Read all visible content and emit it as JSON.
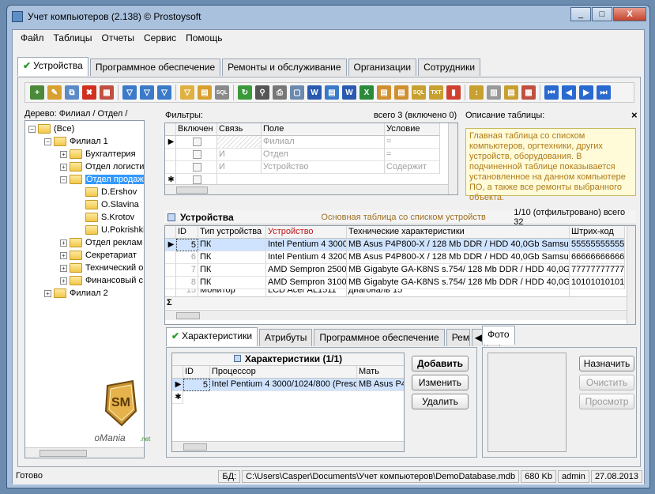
{
  "window": {
    "title": "Учет компьютеров (2.138) © Prostoysoft",
    "min": "_",
    "max": "□",
    "close": "X"
  },
  "menu": [
    "Файл",
    "Таблицы",
    "Отчеты",
    "Сервис",
    "Помощь"
  ],
  "tabs": [
    "Устройства",
    "Программное обеспечение",
    "Ремонты и обслуживание",
    "Организации",
    "Сотрудники"
  ],
  "tree": {
    "label": "Дерево: Филиал / Отдел /",
    "nodes": [
      "(Все)",
      "Филиал 1",
      "Бухгалтерия",
      "Отдел логисти",
      "Отдел продаж",
      "D.Ershov",
      "O.Slavina",
      "S.Krotov",
      "U.Pokrishki",
      "Отдел реклам",
      "Секретариат",
      "Технический о",
      "Финансовый с",
      "Филиал 2"
    ]
  },
  "filters": {
    "label": "Фильтры:",
    "total": "всего 3 (включено 0)",
    "columns": [
      "Включен",
      "Связь",
      "Поле",
      "Условие"
    ],
    "rows": [
      {
        "link": "",
        "field": "Филиал",
        "cond": "="
      },
      {
        "link": "И",
        "field": "Отдел",
        "cond": "="
      },
      {
        "link": "И",
        "field": "Устройство",
        "cond": "Содержит"
      }
    ]
  },
  "table_desc": {
    "label": "Описание таблицы:",
    "close": "×",
    "text": "Главная таблица со списком компьютеров, оргтехники, других устройств, оборудования. В подчиненной таблице показывается установленное на данном компьютере ПО, а также все ремонты выбранного объекта."
  },
  "devices": {
    "title": "Устройства",
    "subtitle": "Основная таблица со списком устройств",
    "count": "1/10 (отфильтровано) всего 32",
    "columns": [
      "ID",
      "Тип устройства",
      "Устройство",
      "Технические характеристики",
      "Штрих-код"
    ],
    "rows": [
      {
        "id": "5",
        "type": "ПК",
        "device": "Intel Pentium 4 3000",
        "tech": "MB Asus P4P800-X / 128 Mb DDR / HDD 40,0Gb Samsun",
        "code": "555555555555"
      },
      {
        "id": "6",
        "type": "ПК",
        "device": "Intel Pentium 4 3200",
        "tech": "MB Asus P4P800-X / 128 Mb DDR / HDD 40,0Gb Samsun",
        "code": "666666666666"
      },
      {
        "id": "7",
        "type": "ПК",
        "device": "AMD Sempron 2500",
        "tech": "MB Gigabyte GA-K8NS s.754/ 128 Mb DDR / HDD 40,0G",
        "code": "777777777777"
      },
      {
        "id": "8",
        "type": "ПК",
        "device": "AMD Sempron 3100",
        "tech": "MB Gigabyte GA-K8NS s.754/ 128 Mb DDR / HDD 40,0G",
        "code": "101010101010"
      },
      {
        "id": "15",
        "type": "Монитор",
        "device": "LCD Acer AL1511",
        "tech": "диагональ 15\"",
        "code": ""
      }
    ],
    "sigma": "Σ"
  },
  "subtabs": [
    "Характеристики",
    "Атрибуты",
    "Программное обеспечение",
    "Рем"
  ],
  "chars": {
    "title": "Характеристики (1/1)",
    "columns": [
      "ID",
      "Процессор",
      "Мать"
    ],
    "row": {
      "id": "5",
      "cpu": "Intel Pentium 4 3000/1024/800 (Presc",
      "mb": "MB Asus P4P"
    }
  },
  "buttons": {
    "add": "Добавить",
    "edit": "Изменить",
    "delete": "Удалить"
  },
  "photo": {
    "tab": "Фото",
    "assign": "Назначить",
    "clear": "Очистить",
    "view": "Просмотр"
  },
  "status": {
    "ready": "Готово",
    "db_label": "БД:",
    "db_path": "C:\\Users\\Casper\\Documents\\Учет компьютеров\\DemoDatabase.mdb",
    "size": "680 Kb",
    "user": "admin",
    "date": "27.08.2013"
  },
  "watermark": {
    "logo": "SM",
    "text": "SoftoMania",
    "suffix": ".net"
  }
}
